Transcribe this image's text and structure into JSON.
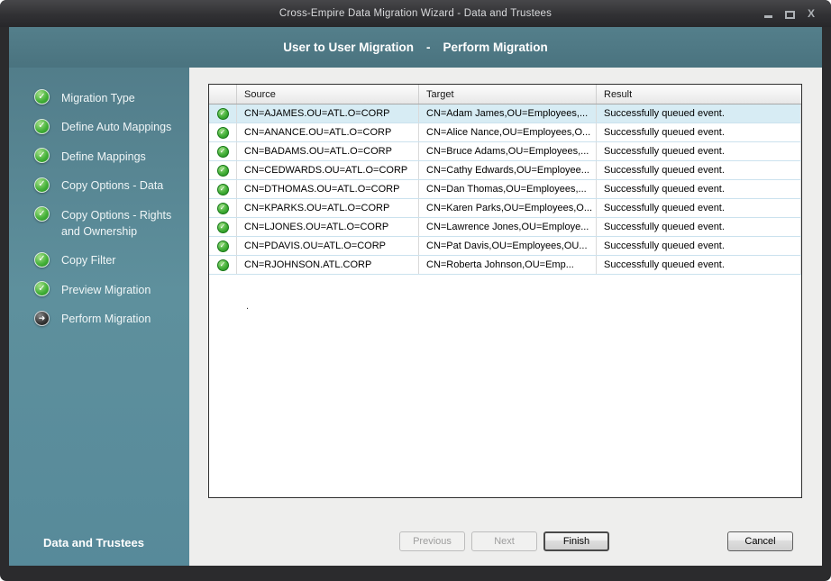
{
  "window": {
    "title": "Cross-Empire Data Migration Wizard - Data and Trustees",
    "controls": {
      "close_glyph": "X"
    }
  },
  "header": {
    "title_left": "User to User Migration",
    "separator": "-",
    "title_right": "Perform Migration"
  },
  "icons": {
    "check": "✓",
    "current_arrow": "➜"
  },
  "sidebar": {
    "items": [
      {
        "label": "Migration Type",
        "state": "done"
      },
      {
        "label": "Define Auto Mappings",
        "state": "done"
      },
      {
        "label": "Define Mappings",
        "state": "done"
      },
      {
        "label": "Copy Options - Data",
        "state": "done"
      },
      {
        "label": "Copy Options - Rights and Ownership",
        "state": "done"
      },
      {
        "label": "Copy Filter",
        "state": "done"
      },
      {
        "label": "Preview Migration",
        "state": "done"
      },
      {
        "label": "Perform Migration",
        "state": "current"
      }
    ],
    "footer": "Data and Trustees"
  },
  "table": {
    "columns": [
      "",
      "Source",
      "Target",
      "Result"
    ],
    "rows": [
      {
        "source": "CN=AJAMES.OU=ATL.O=CORP",
        "target": "CN=Adam James,OU=Employees,...",
        "result": "Successfully queued event.",
        "selected": true
      },
      {
        "source": "CN=ANANCE.OU=ATL.O=CORP",
        "target": "CN=Alice Nance,OU=Employees,O...",
        "result": "Successfully queued event.",
        "selected": false
      },
      {
        "source": "CN=BADAMS.OU=ATL.O=CORP",
        "target": "CN=Bruce Adams,OU=Employees,...",
        "result": "Successfully queued event.",
        "selected": false
      },
      {
        "source": "CN=CEDWARDS.OU=ATL.O=CORP",
        "target": "CN=Cathy Edwards,OU=Employee...",
        "result": "Successfully queued event.",
        "selected": false
      },
      {
        "source": "CN=DTHOMAS.OU=ATL.O=CORP",
        "target": "CN=Dan Thomas,OU=Employees,...",
        "result": "Successfully queued event.",
        "selected": false
      },
      {
        "source": "CN=KPARKS.OU=ATL.O=CORP",
        "target": "CN=Karen Parks,OU=Employees,O...",
        "result": "Successfully queued event.",
        "selected": false
      },
      {
        "source": "CN=LJONES.OU=ATL.O=CORP",
        "target": "CN=Lawrence Jones,OU=Employe...",
        "result": "Successfully queued event.",
        "selected": false
      },
      {
        "source": "CN=PDAVIS.OU=ATL.O=CORP",
        "target": "CN=Pat Davis,OU=Employees,OU...",
        "result": "Successfully queued event.",
        "selected": false
      },
      {
        "source": "CN=RJOHNSON.ATL.CORP",
        "target": "CN=Roberta Johnson,OU=Emp...",
        "result": "Successfully queued event.",
        "selected": false
      }
    ],
    "stray_text": "."
  },
  "buttons": {
    "previous": {
      "label": "Previous",
      "enabled": false
    },
    "next": {
      "label": "Next",
      "enabled": false
    },
    "finish": {
      "label": "Finish",
      "enabled": true,
      "default": true
    },
    "cancel": {
      "label": "Cancel",
      "enabled": true
    }
  },
  "colors": {
    "teal_band": "#4d7884",
    "sidebar": "#5b8c99",
    "selected_row": "#d7ecf4",
    "success_green": "#2f9e2f",
    "titlebar": "#2e2e30"
  }
}
